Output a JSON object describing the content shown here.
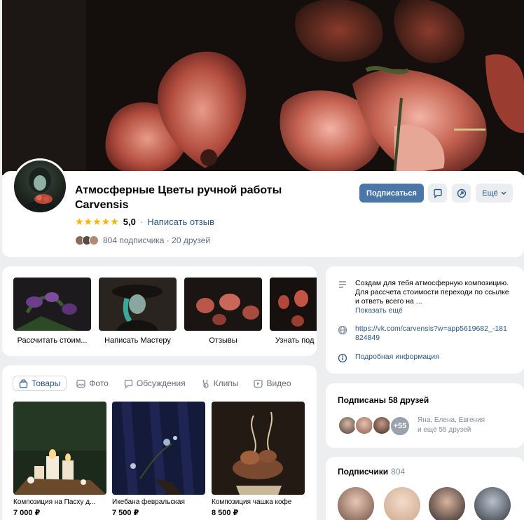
{
  "group": {
    "title": "Атмосферные Цветы ручной работы Carvensis",
    "rating": "5,0",
    "write_review": "Написать отзыв",
    "subscribers_text": "804 подписчика · 20 друзей",
    "subscribe_label": "Подписаться",
    "more_label": "Ещё"
  },
  "services": [
    {
      "label": "Рассчитать стоим..."
    },
    {
      "label": "Написать Мастеру"
    },
    {
      "label": "Отзывы"
    },
    {
      "label": "Узнать под"
    }
  ],
  "tabs": [
    {
      "label": "Товары",
      "icon": "bag-icon"
    },
    {
      "label": "Фото",
      "icon": "photo-icon"
    },
    {
      "label": "Обсуждения",
      "icon": "chat-icon"
    },
    {
      "label": "Клипы",
      "icon": "clips-icon"
    },
    {
      "label": "Видео",
      "icon": "video-icon"
    }
  ],
  "products": [
    {
      "name": "Композиция на Пасху д...",
      "price": "7 000 ₽"
    },
    {
      "name": "Икебана февральская",
      "price": "7 500 ₽"
    },
    {
      "name": "Композиция чашка кофе",
      "price": "8 500 ₽"
    }
  ],
  "about": {
    "description": "Создам для тебя атмосферную композицию. Для рассчета стоимости переходи по ссылке и ответь всего на ...",
    "show_more": "Показать ещё",
    "link": "https://vk.com/carvensis?w=app5619682_-181824849",
    "details": "Подробная информация"
  },
  "friends": {
    "title": "Подписаны 58 друзей",
    "plus": "+55",
    "names_line1": "Яна, Елена, Евгения",
    "names_line2": "и ещё 55 друзей"
  },
  "followers": {
    "title": "Подписчики",
    "count": "804"
  },
  "colors": {
    "accent": "#4a76a8",
    "link": "#2a5885",
    "background": "#edeef0",
    "star": "#f4b400"
  }
}
